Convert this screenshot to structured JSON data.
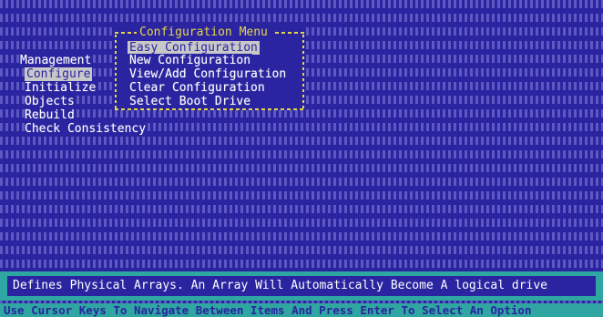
{
  "config_menu": {
    "title": "Configuration Menu",
    "items": [
      {
        "label": "Easy Configuration",
        "selected": true
      },
      {
        "label": "New Configuration",
        "selected": false
      },
      {
        "label": "View/Add Configuration",
        "selected": false
      },
      {
        "label": "Clear Configuration",
        "selected": false
      },
      {
        "label": "Select Boot Drive",
        "selected": false
      }
    ]
  },
  "main_menu": {
    "items": [
      {
        "label": "Management",
        "selected": false
      },
      {
        "label": "Configure",
        "selected": true
      },
      {
        "label": "Initialize",
        "selected": false
      },
      {
        "label": "Objects",
        "selected": false
      },
      {
        "label": "Rebuild",
        "selected": false
      },
      {
        "label": "Check Consistency",
        "selected": false
      }
    ]
  },
  "description": "Defines Physical Arrays. An Array Will Automatically Become A logical drive",
  "help": "Use Cursor Keys To Navigate Between Items And Press Enter To Select An Option",
  "colors": {
    "background": "#2a24a0",
    "menu_frame": "#e4d64a",
    "status_bar": "#2fa6a1",
    "highlight": "#c8c8c8"
  }
}
